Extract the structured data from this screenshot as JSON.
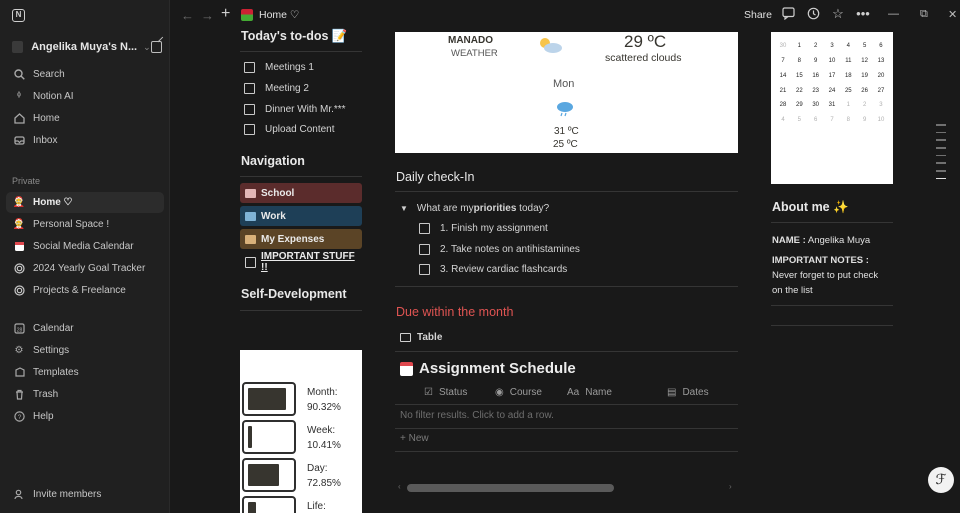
{
  "workspace": {
    "name": "Angelika Muya's N..."
  },
  "sidebar": {
    "top_items": [
      {
        "label": "Search",
        "icon": "search-icon"
      },
      {
        "label": "Notion AI",
        "icon": "ai-icon"
      },
      {
        "label": "Home",
        "icon": "home-icon"
      },
      {
        "label": "Inbox",
        "icon": "inbox-icon"
      }
    ],
    "section_label": "Private",
    "private_items": [
      {
        "label": "Home ♡",
        "icon": "page-icon",
        "active": true
      },
      {
        "label": "Personal Space !",
        "icon": "page-icon"
      },
      {
        "label": "Social Media Calendar",
        "icon": "calendar-page-icon"
      },
      {
        "label": "2024 Yearly Goal Tracker",
        "icon": "target-icon"
      },
      {
        "label": "Projects & Freelance",
        "icon": "target-icon"
      }
    ],
    "bottom_items": [
      {
        "label": "Calendar",
        "icon": "calendar-icon"
      },
      {
        "label": "Settings",
        "icon": "gear-icon"
      },
      {
        "label": "Templates",
        "icon": "templates-icon"
      },
      {
        "label": "Trash",
        "icon": "trash-icon"
      },
      {
        "label": "Help",
        "icon": "help-icon"
      }
    ],
    "invite_label": "Invite members"
  },
  "topbar": {
    "breadcrumb": "Home ♡",
    "share_label": "Share"
  },
  "todos": {
    "title": "Today's to-dos 📝",
    "items": [
      "Meetings 1",
      "Meeting 2",
      "Dinner With Mr.***",
      "Upload Content"
    ]
  },
  "navigation": {
    "title": "Navigation",
    "buttons": [
      {
        "label": "School",
        "bg": "#5b2c2c",
        "icon_color": "#e3b7b7"
      },
      {
        "label": "Work",
        "bg": "#1e3f57",
        "icon_color": "#7fb3d6"
      },
      {
        "label": "My Expenses",
        "bg": "#5b4426",
        "icon_color": "#d9b17a"
      },
      {
        "label": "IMPORTANT STUFF !!",
        "bg": "transparent",
        "icon_color": "#cfcfcf"
      }
    ]
  },
  "self_dev": {
    "title": "Self-Development"
  },
  "progress": [
    {
      "label": "Month:",
      "value": "90.32%",
      "fraction": 0.9032
    },
    {
      "label": "Week:",
      "value": "10.41%",
      "fraction": 0.1041
    },
    {
      "label": "Day:",
      "value": "72.85%",
      "fraction": 0.7285
    },
    {
      "label": "Life:",
      "value": "",
      "fraction": 0.2
    }
  ],
  "weather": {
    "city": "MANADO",
    "sub": "WEATHER",
    "temp": "29 ºC",
    "desc": "scattered clouds",
    "day": "Mon",
    "hi": "31 ºC",
    "lo": "25 ºC"
  },
  "checkin": {
    "title": "Daily check-In",
    "toggle_prefix": "What are my ",
    "toggle_bold": "priorities",
    "toggle_suffix": " today?",
    "tasks": [
      "1. Finish my assignment",
      "2. Take notes on antihistamines",
      "3. Review cardiac flashcards"
    ]
  },
  "due": {
    "title": "Due within the month",
    "view_label": "Table",
    "db_title": "Assignment Schedule",
    "columns": [
      {
        "label": "Status",
        "icon": "☑"
      },
      {
        "label": "Course",
        "icon": "◉"
      },
      {
        "label": "Name",
        "icon": "Aa"
      },
      {
        "label": "Dates",
        "icon": "▤"
      }
    ],
    "empty_message": "No filter results. Click to add a row.",
    "new_label": "+ New"
  },
  "calendar": {
    "rows": [
      [
        "30",
        "1",
        "2",
        "3",
        "4",
        "5",
        "6"
      ],
      [
        "7",
        "8",
        "9",
        "10",
        "11",
        "12",
        "13"
      ],
      [
        "14",
        "15",
        "16",
        "17",
        "18",
        "19",
        "20"
      ],
      [
        "21",
        "22",
        "23",
        "24",
        "25",
        "26",
        "27"
      ],
      [
        "28",
        "29",
        "30",
        "31",
        "1",
        "2",
        "3"
      ],
      [
        "4",
        "5",
        "6",
        "7",
        "8",
        "9",
        "10"
      ]
    ]
  },
  "about": {
    "title": "About me ✨",
    "name_label": "NAME :",
    "name_value": " Angelika Muya",
    "notes_label": "IMPORTANT NOTES :",
    "notes_l1": "Never forget to put check",
    "notes_l2": "on the list"
  }
}
